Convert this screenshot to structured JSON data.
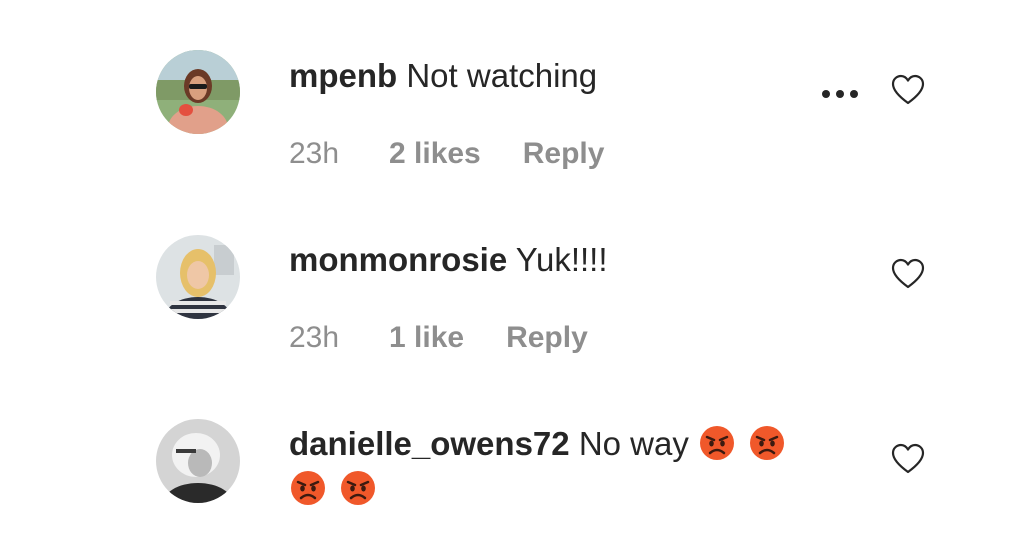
{
  "comments": [
    {
      "username": "mpenb",
      "text": "Not watching",
      "time": "23h",
      "likes": "2 likes",
      "reply": "Reply",
      "emojis": []
    },
    {
      "username": "monmonrosie",
      "text": "Yuk!!!!",
      "time": "23h",
      "likes": "1 like",
      "reply": "Reply",
      "emojis": []
    },
    {
      "username": "danielle_owens72",
      "text": "No way",
      "emojis": [
        "angry-face-emoji",
        "angry-face-emoji",
        "angry-face-emoji",
        "angry-face-emoji"
      ]
    }
  ],
  "icons": {
    "more": "more-options-icon",
    "like": "heart-icon"
  },
  "colors": {
    "text": "#262626",
    "meta": "#8e8e8e",
    "emoji": "#f0582a"
  }
}
